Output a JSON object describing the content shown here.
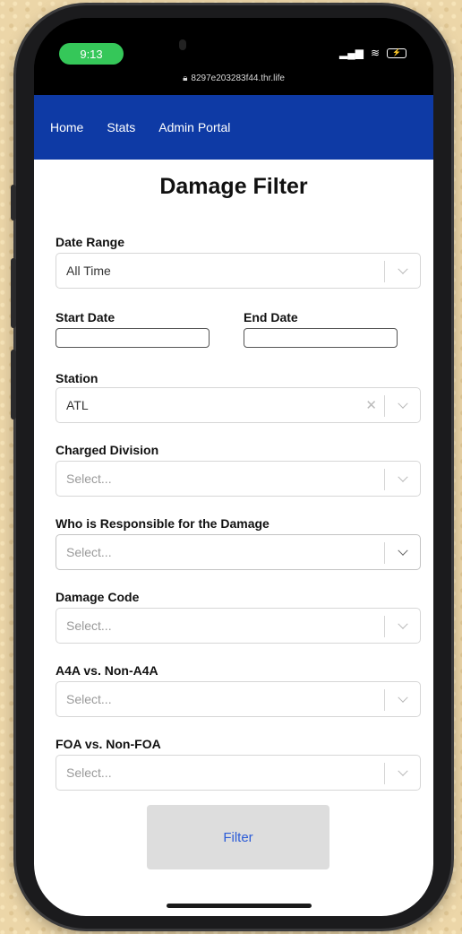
{
  "status": {
    "time": "9:13",
    "battery": "⚡"
  },
  "browser": {
    "url": "8297e203283f44.thr.life"
  },
  "nav": {
    "links": [
      "Home",
      "Stats",
      "Admin Portal"
    ]
  },
  "page": {
    "title": "Damage Filter"
  },
  "form": {
    "date_range": {
      "label": "Date Range",
      "value": "All Time"
    },
    "start_date": {
      "label": "Start Date",
      "value": ""
    },
    "end_date": {
      "label": "End Date",
      "value": ""
    },
    "station": {
      "label": "Station",
      "value": "ATL"
    },
    "charged_division": {
      "label": "Charged Division",
      "placeholder": "Select..."
    },
    "responsible": {
      "label": "Who is Responsible for the Damage",
      "placeholder": "Select..."
    },
    "damage_code": {
      "label": "Damage Code",
      "placeholder": "Select..."
    },
    "a4a": {
      "label": "A4A vs. Non-A4A",
      "placeholder": "Select..."
    },
    "foa": {
      "label": "FOA vs. Non-FOA",
      "placeholder": "Select..."
    },
    "filter_button": "Filter"
  }
}
